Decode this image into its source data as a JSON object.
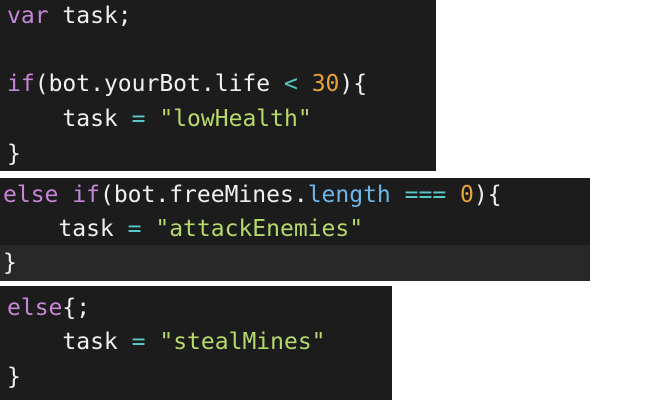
{
  "block_1": {
    "line_1": {
      "kw": "var",
      "sp": " ",
      "id": "task",
      "end": ";"
    },
    "line_3": {
      "kw": "if",
      "open": "(",
      "obj": "bot.yourBot.life",
      "op": "<",
      "num": "30",
      "close": "){"
    },
    "line_4": {
      "indent": "    ",
      "id": "task",
      "op": "=",
      "str": "\"lowHealth\""
    },
    "line_5": {
      "brace": "}"
    }
  },
  "block_2": {
    "line_1": {
      "kw1": "else",
      "kw2": "if",
      "open": "(",
      "obj": "bot.freeMines.",
      "prop": "length",
      "op": "===",
      "num": "0",
      "close": "){"
    },
    "line_2": {
      "indent": "    ",
      "id": "task",
      "op": "=",
      "str": "\"attackEnemies\""
    },
    "line_3": {
      "brace": "}"
    }
  },
  "block_3": {
    "line_1": {
      "kw": "else",
      "punc": "{;"
    },
    "line_2": {
      "indent": "    ",
      "id": "task",
      "op": "=",
      "str": "\"stealMines\""
    },
    "line_3": {
      "brace": "}"
    }
  },
  "colors": {
    "background": "#1c1c1c",
    "highlight_line": "#282828",
    "keyword": "#c586d6",
    "identifier": "#f0f0f0",
    "property": "#6cb6e8",
    "operator": "#5ac8c8",
    "number": "#e8a23a",
    "string": "#b6d96b"
  }
}
